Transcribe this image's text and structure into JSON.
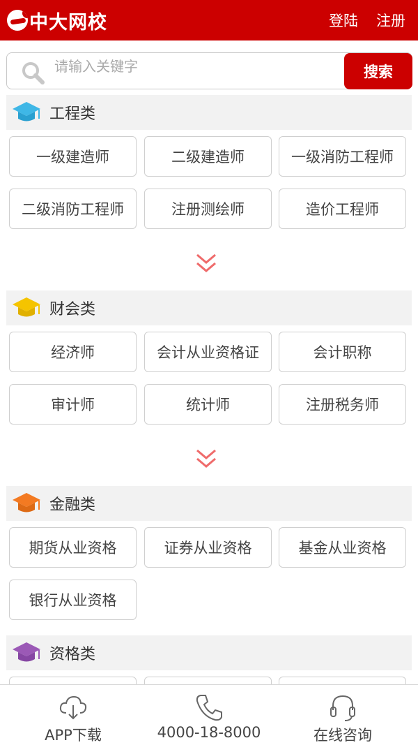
{
  "header": {
    "logo_text": "中大网校",
    "login": "登陆",
    "register": "注册"
  },
  "search": {
    "placeholder": "请输入关键字",
    "button": "搜索"
  },
  "colors": {
    "brand": "#cc0000",
    "cap_engineering": "#3fb7e6",
    "cap_finance": "#f5c400",
    "cap_banking": "#f37a22",
    "cap_qualification": "#9b59b6",
    "chevron": "#ef6b6b"
  },
  "categories": [
    {
      "title": "工程类",
      "icon": "graduation-cap-icon",
      "items": [
        "一级建造师",
        "二级建造师",
        "一级消防工程师",
        "二级消防工程师",
        "注册测绘师",
        "造价工程师"
      ]
    },
    {
      "title": "财会类",
      "icon": "graduation-cap-icon",
      "items": [
        "经济师",
        "会计从业资格证",
        "会计职称",
        "审计师",
        "统计师",
        "注册税务师"
      ]
    },
    {
      "title": "金融类",
      "icon": "graduation-cap-icon",
      "items": [
        "期货从业资格",
        "证券从业资格",
        "基金从业资格",
        "银行从业资格"
      ]
    },
    {
      "title": "资格类",
      "icon": "graduation-cap-icon",
      "items": []
    }
  ],
  "bottom_bar": {
    "app": "APP下载",
    "phone": "4000-18-8000",
    "consult": "在线咨询"
  }
}
